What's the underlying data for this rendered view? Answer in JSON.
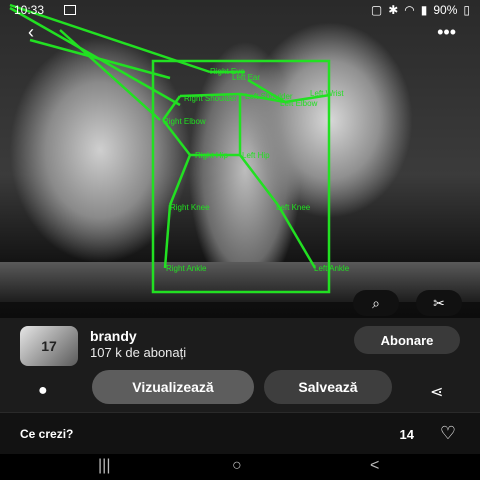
{
  "status": {
    "time": "10:33",
    "battery": "90%",
    "icons": [
      "image-icon",
      "nfc-icon",
      "bluetooth-icon",
      "wifi-icon",
      "volte-icon",
      "signal-icon"
    ]
  },
  "top": {
    "back_icon": "chevron-left-icon",
    "more_icon": "more-dots-icon"
  },
  "overlay": {
    "color": "#22e022",
    "labels": {
      "right_eye": "Right Eye",
      "left_ear": "Left Ear",
      "right_shoulder": "Right Shoulder",
      "left_shoulder": "Left Shoulder",
      "left_wrist": "Left Wrist",
      "left_elbow": "Left Elbow",
      "right_elbow": "Right Elbow",
      "right_hip": "Right Hip",
      "left_hip": "Left Hip",
      "right_knee": "Right Knee",
      "left_knee": "Left Knee",
      "right_ankle": "Right Ankle",
      "left_ankle": "Left Ankle"
    }
  },
  "photo_buttons": {
    "lens_icon": "lens-search-icon",
    "scissors_icon": "scissors-icon"
  },
  "user": {
    "avatar_text": "17",
    "name": "brandy",
    "subscribers": "107 k de abonați",
    "subscribe_label": "Abonare"
  },
  "actions": {
    "view_label": "Vizualizează",
    "save_label": "Salvează",
    "chat_icon": "chat-bubble-icon",
    "share_icon": "share-icon"
  },
  "comments": {
    "prompt": "Ce crezi?",
    "likes": "14",
    "heart_icon": "heart-outline-icon"
  },
  "navbar": {
    "recents": "|||",
    "home": "○",
    "back": "<"
  }
}
